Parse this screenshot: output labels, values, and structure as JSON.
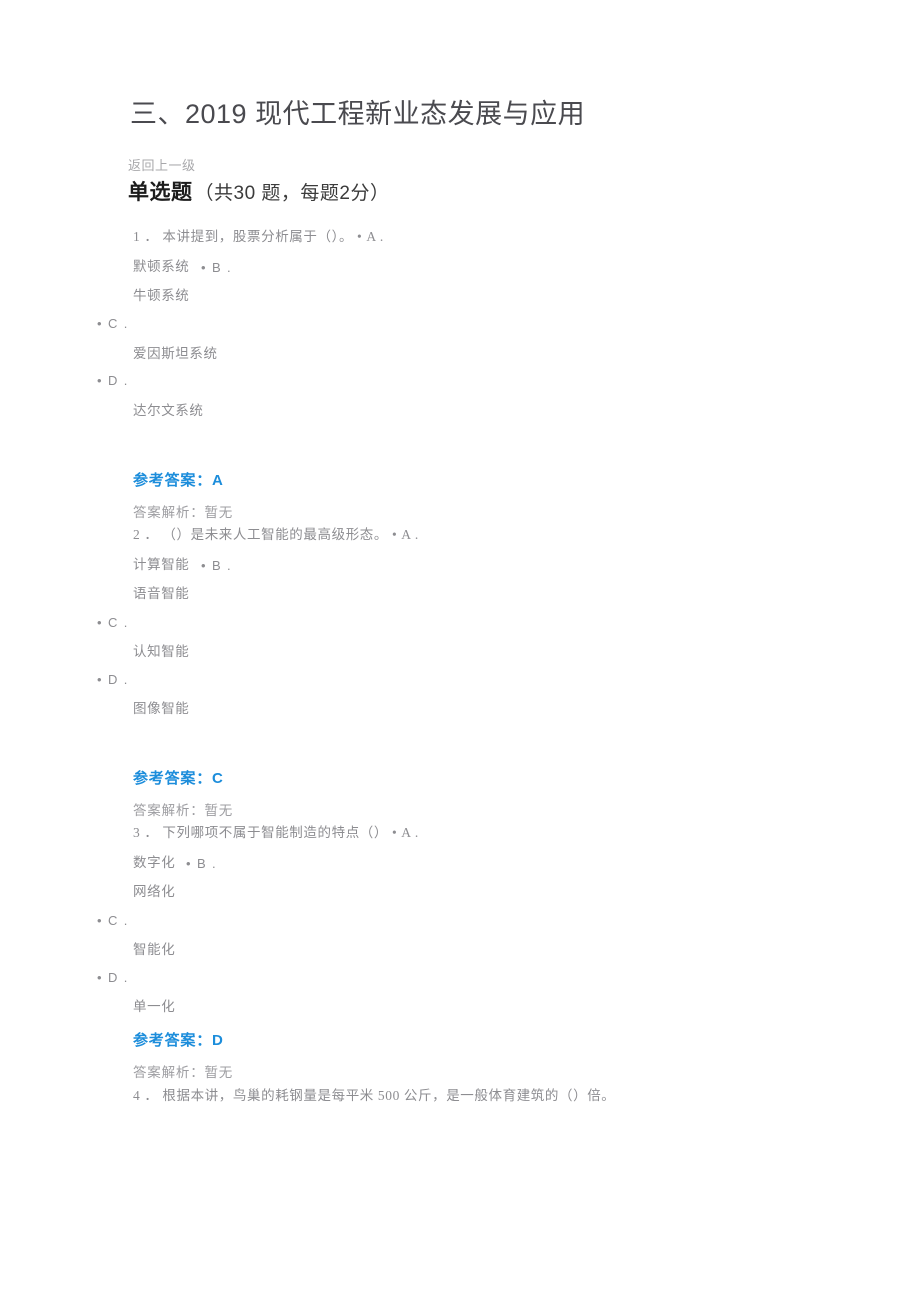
{
  "page": {
    "title": "三、2019 现代工程新业态发展与应用",
    "back_link": "返回上一级",
    "section": {
      "name": "单选题",
      "meta": "（共30 题，每题2分）"
    }
  },
  "labels": {
    "ref_answer_prefix": "参考答案：",
    "analysis_prefix": "答案解析：",
    "analysis_none": "暂无",
    "analysis_line": "答案解析：暂无",
    "bullet": "•"
  },
  "questions": [
    {
      "number": "1",
      "number_dot": "．",
      "stem": "本讲提到，股票分析属于（）。",
      "line1": "1 ． 本讲提到，股票分析属于（）。 • A .",
      "inline_a_marker": "• A .",
      "option_a_text": "默顿系统",
      "inline_b_marker": "• B .",
      "option_b_text": "牛顿系统",
      "marker_c": "• C .",
      "option_c_text": "爱因斯坦系统",
      "marker_d": "• D .",
      "option_d_text": "达尔文系统",
      "answer": "A",
      "ref_answer_line": "参考答案：A",
      "analysis": "暂无"
    },
    {
      "number": "2",
      "number_dot": "．",
      "stem": "（）是未来人工智能的最高级形态。",
      "line1": "2 ． （）是未来人工智能的最高级形态。 • A .",
      "inline_a_marker": "• A .",
      "option_a_text": "计算智能",
      "inline_b_marker": "• B .",
      "option_b_text": "语音智能",
      "marker_c": "• C .",
      "option_c_text": "认知智能",
      "marker_d": "• D .",
      "option_d_text": "图像智能",
      "answer": "C",
      "ref_answer_line": "参考答案：C",
      "analysis": "暂无"
    },
    {
      "number": "3",
      "number_dot": "．",
      "stem": "下列哪项不属于智能制造的特点（）",
      "line1": "3 ． 下列哪项不属于智能制造的特点（） • A .",
      "inline_a_marker": "• A .",
      "option_a_text": "数字化",
      "inline_b_marker": "• B .",
      "option_b_text": "网络化",
      "marker_c": "• C .",
      "option_c_text": "智能化",
      "marker_d": "• D .",
      "option_d_text": "单一化",
      "answer": "D",
      "ref_answer_line": "参考答案：D",
      "analysis": "暂无"
    },
    {
      "number": "4",
      "number_dot": "．",
      "stem": "根据本讲，鸟巢的耗钢量是每平米 500 公斤，是一般体育建筑的（）倍。",
      "line1": "4 ． 根据本讲，鸟巢的耗钢量是每平米 500 公斤，是一般体育建筑的（）倍。"
    }
  ]
}
